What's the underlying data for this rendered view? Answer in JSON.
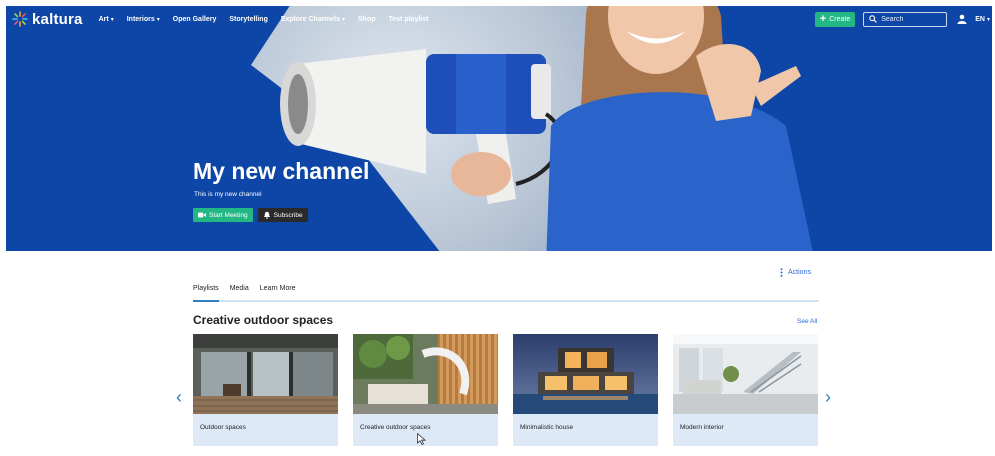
{
  "brand": {
    "name": "kaltura"
  },
  "nav": {
    "menu": [
      {
        "label": "Art",
        "has_dropdown": true
      },
      {
        "label": "Interiors",
        "has_dropdown": true
      },
      {
        "label": "Open Gallery",
        "has_dropdown": false
      },
      {
        "label": "Storytelling",
        "has_dropdown": false
      },
      {
        "label": "Explore Channels",
        "has_dropdown": true
      },
      {
        "label": "Shop",
        "has_dropdown": false
      },
      {
        "label": "Test playlist",
        "has_dropdown": false
      }
    ],
    "create_label": "Create",
    "search_placeholder": "Search",
    "language": "EN"
  },
  "hero": {
    "title": "My new channel",
    "description": "This is my new channel",
    "start_meeting_label": "Start Meeting",
    "subscribe_label": "Subscribe"
  },
  "channel": {
    "actions_label": "Actions",
    "tabs": [
      {
        "label": "Playlists",
        "active": true
      },
      {
        "label": "Media",
        "active": false
      },
      {
        "label": "Learn More",
        "active": false
      }
    ]
  },
  "playlist": {
    "title": "Creative outdoor spaces",
    "see_all_label": "See All",
    "cards": [
      {
        "title": "Outdoor spaces"
      },
      {
        "title": "Creative outdoor spaces"
      },
      {
        "title": "Minimalistic house"
      },
      {
        "title": "Modern interior"
      }
    ]
  },
  "colors": {
    "hero_blue": "#0d46a6",
    "accent_green": "#22b783",
    "link_blue": "#2d6ad9",
    "card_bg": "#dde9f6"
  },
  "icons": {
    "logo": "kaltura-star-icon",
    "create": "plus-icon",
    "search": "search-icon",
    "user": "user-icon",
    "meeting": "video-camera-icon",
    "subscribe": "bell-icon",
    "actions": "kebab-menu-icon",
    "prev": "chevron-left-icon",
    "next": "chevron-right-icon"
  }
}
